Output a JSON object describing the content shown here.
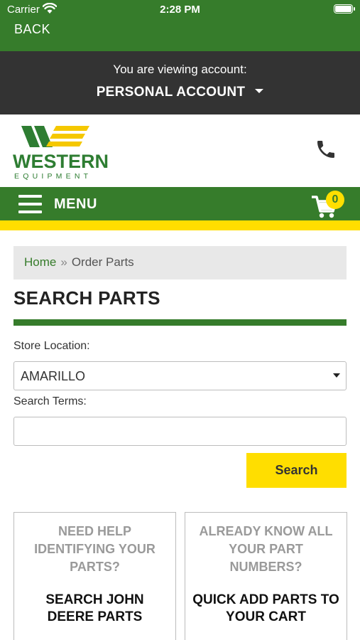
{
  "status_bar": {
    "carrier": "Carrier",
    "time": "2:28 PM"
  },
  "nav": {
    "back_label": "BACK"
  },
  "account": {
    "label": "You are viewing account:",
    "name": "PERSONAL ACCOUNT"
  },
  "brand": {
    "name": "WESTERN",
    "sub": "EQUIPMENT",
    "colors": {
      "green": "#367c2b",
      "yellow": "#ffde00"
    }
  },
  "menu": {
    "label": "MENU",
    "cart_count": "0"
  },
  "breadcrumb": {
    "home": "Home",
    "separator": "»",
    "current": "Order Parts"
  },
  "page": {
    "title": "SEARCH PARTS"
  },
  "form": {
    "store_label": "Store Location:",
    "store_value": "AMARILLO",
    "terms_label": "Search Terms:",
    "terms_value": "",
    "search_button": "Search"
  },
  "cards": [
    {
      "question": "NEED HELP IDENTIFYING YOUR PARTS?",
      "action": "SEARCH JOHN DEERE PARTS"
    },
    {
      "question": "ALREADY KNOW ALL YOUR PART NUMBERS?",
      "action": "QUICK ADD PARTS TO YOUR CART"
    }
  ],
  "icons": [
    "wifi-icon",
    "battery-icon",
    "phone-icon",
    "hamburger-icon",
    "cart-icon",
    "dropdown-caret-icon"
  ]
}
